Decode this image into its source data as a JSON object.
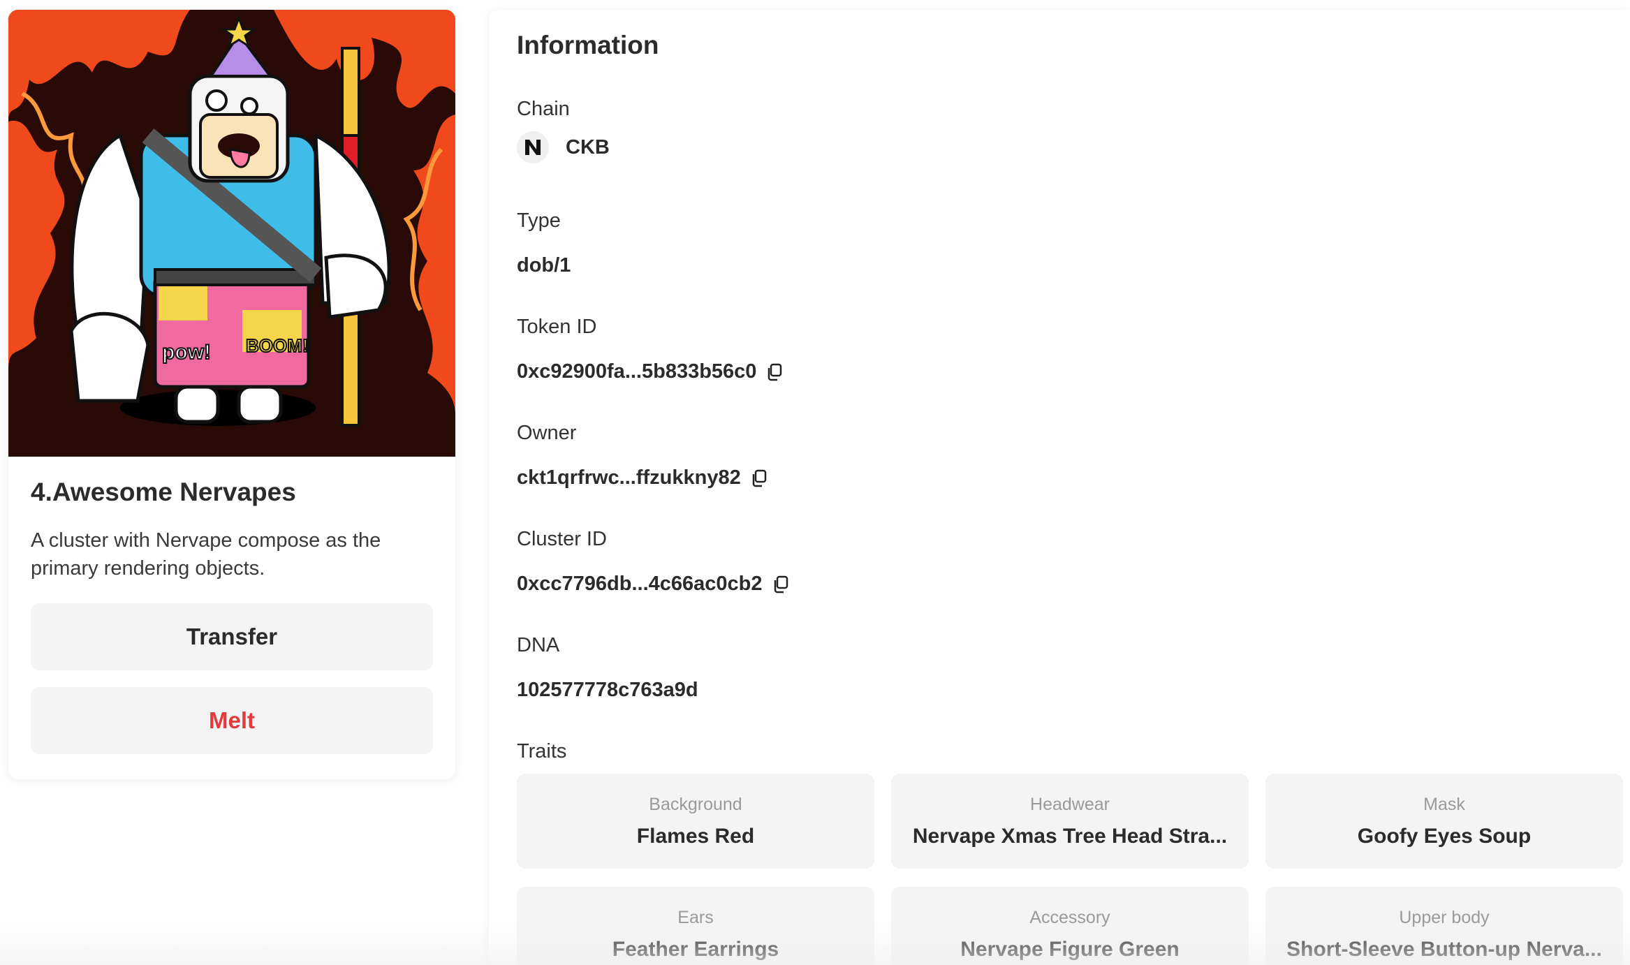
{
  "nft": {
    "title": "4.Awesome Nervapes",
    "description": "A cluster with Nervape compose as the primary rendering objects.",
    "image_alt": "Nervape character with party hat and staff in front of red flames",
    "colors": {
      "background": "#2a0a06",
      "flames": "#f04a1c"
    }
  },
  "actions": {
    "transfer_label": "Transfer",
    "melt_label": "Melt",
    "melt_color": "#e23b3b"
  },
  "info": {
    "heading": "Information",
    "chain": {
      "label": "Chain",
      "name": "CKB",
      "logo_icon": "ckb-logo-icon"
    },
    "type": {
      "label": "Type",
      "value": "dob/1"
    },
    "token_id": {
      "label": "Token ID",
      "value": "0xc92900fa...5b833b56c0"
    },
    "owner": {
      "label": "Owner",
      "value": "ckt1qrfrwc...ffzukkny82"
    },
    "cluster_id": {
      "label": "Cluster ID",
      "value": "0xcc7796db...4c66ac0cb2"
    },
    "dna": {
      "label": "DNA",
      "value": "102577778c763a9d"
    },
    "traits_label": "Traits",
    "traits": [
      {
        "name": "Background",
        "value": "Flames Red"
      },
      {
        "name": "Headwear",
        "value": "Nervape Xmas Tree Head Stra..."
      },
      {
        "name": "Mask",
        "value": "Goofy Eyes Soup"
      },
      {
        "name": "Ears",
        "value": "Feather Earrings"
      },
      {
        "name": "Accessory",
        "value": "Nervape Figure Green"
      },
      {
        "name": "Upper body",
        "value": "Short-Sleeve Button-up Nerva..."
      }
    ]
  }
}
